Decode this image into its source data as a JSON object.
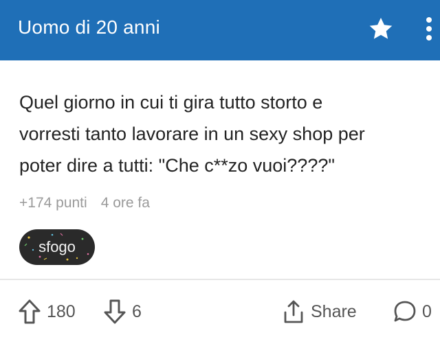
{
  "header": {
    "title": "Uomo di 20 anni",
    "background_color": "#1f6fb7",
    "favorite_icon": "star-icon",
    "more_icon": "more-vert-icon"
  },
  "post": {
    "lines": [
      "Quel giorno in cui ti gira tutto storto e",
      "vorresti tanto lavorare in un sexy shop per",
      "poter dire a tutti: \"Che c**zo vuoi????\""
    ],
    "score": "+174 punti",
    "time": "4 ore fa",
    "tag": "sfogo"
  },
  "actions": {
    "upvotes": "180",
    "downvotes": "6",
    "share_label": "Share",
    "comments": "0"
  }
}
